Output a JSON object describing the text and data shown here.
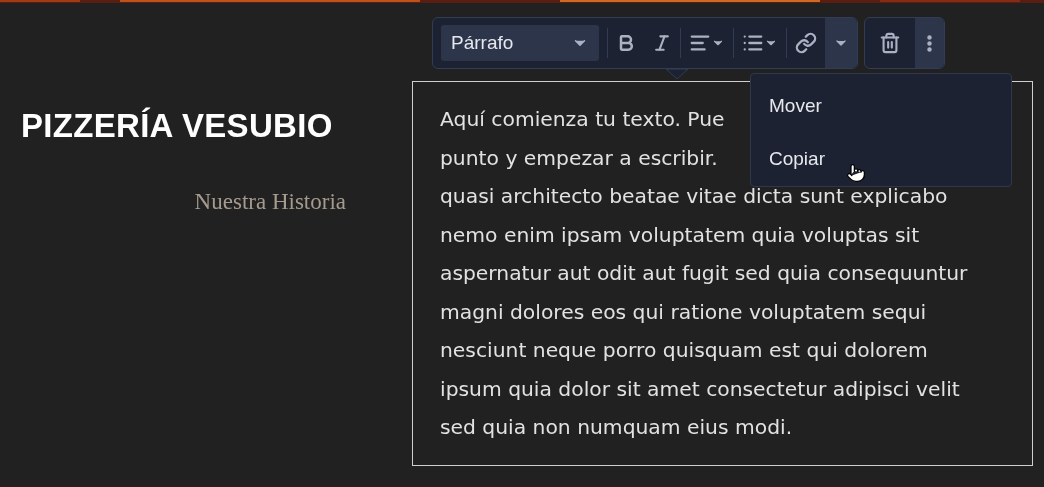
{
  "header": {
    "title": "PIZZERÍA VESUBIO",
    "subtitle": "Nuestra Historia"
  },
  "toolbar": {
    "style_select": {
      "value": "Párrafo"
    },
    "more_menu": {
      "expanded": true
    }
  },
  "menu": {
    "items": [
      {
        "label": "Mover"
      },
      {
        "label": "Copiar"
      }
    ]
  },
  "text_block": {
    "lines": [
      "Aquí comienza tu texto. Pue",
      "punto y empezar a escribir.",
      "quasi architecto beatae vitae dicta sunt explicabo",
      "nemo enim ipsam voluptatem quia voluptas sit",
      "aspernatur aut odit aut fugit sed quia consequuntur",
      "magni dolores eos qui ratione voluptatem sequi",
      "nesciunt neque porro quisquam est qui dolorem",
      "ipsum quia dolor sit amet consectetur adipisci velit",
      "sed quia non numquam eius modi."
    ]
  }
}
